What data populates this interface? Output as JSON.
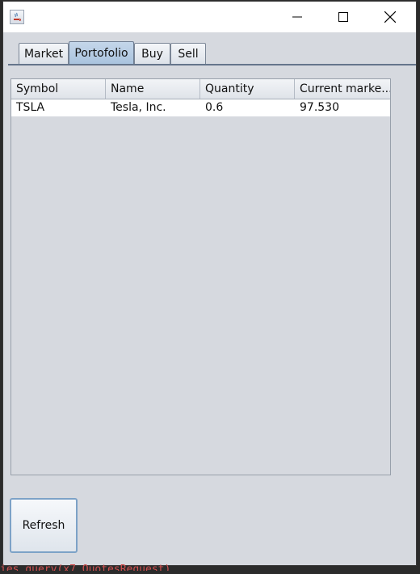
{
  "window": {
    "title": ""
  },
  "tabs": [
    {
      "label": "Market",
      "selected": false
    },
    {
      "label": "Portofolio",
      "selected": true
    },
    {
      "label": "Buy",
      "selected": false
    },
    {
      "label": "Sell",
      "selected": false
    }
  ],
  "table": {
    "headers": [
      "Symbol",
      "Name",
      "Quantity",
      "Current marke..."
    ],
    "rows": [
      [
        "TSLA",
        "Tesla, Inc.",
        "0.6",
        "97.530"
      ]
    ]
  },
  "refresh_label": "Refresh",
  "background_code": "ies.query(x7 QuotesRequest)",
  "colors": {
    "selected_tab": "#b3cbe3",
    "window_bg": "#d6d9df",
    "button_border": "#7da2c7"
  }
}
